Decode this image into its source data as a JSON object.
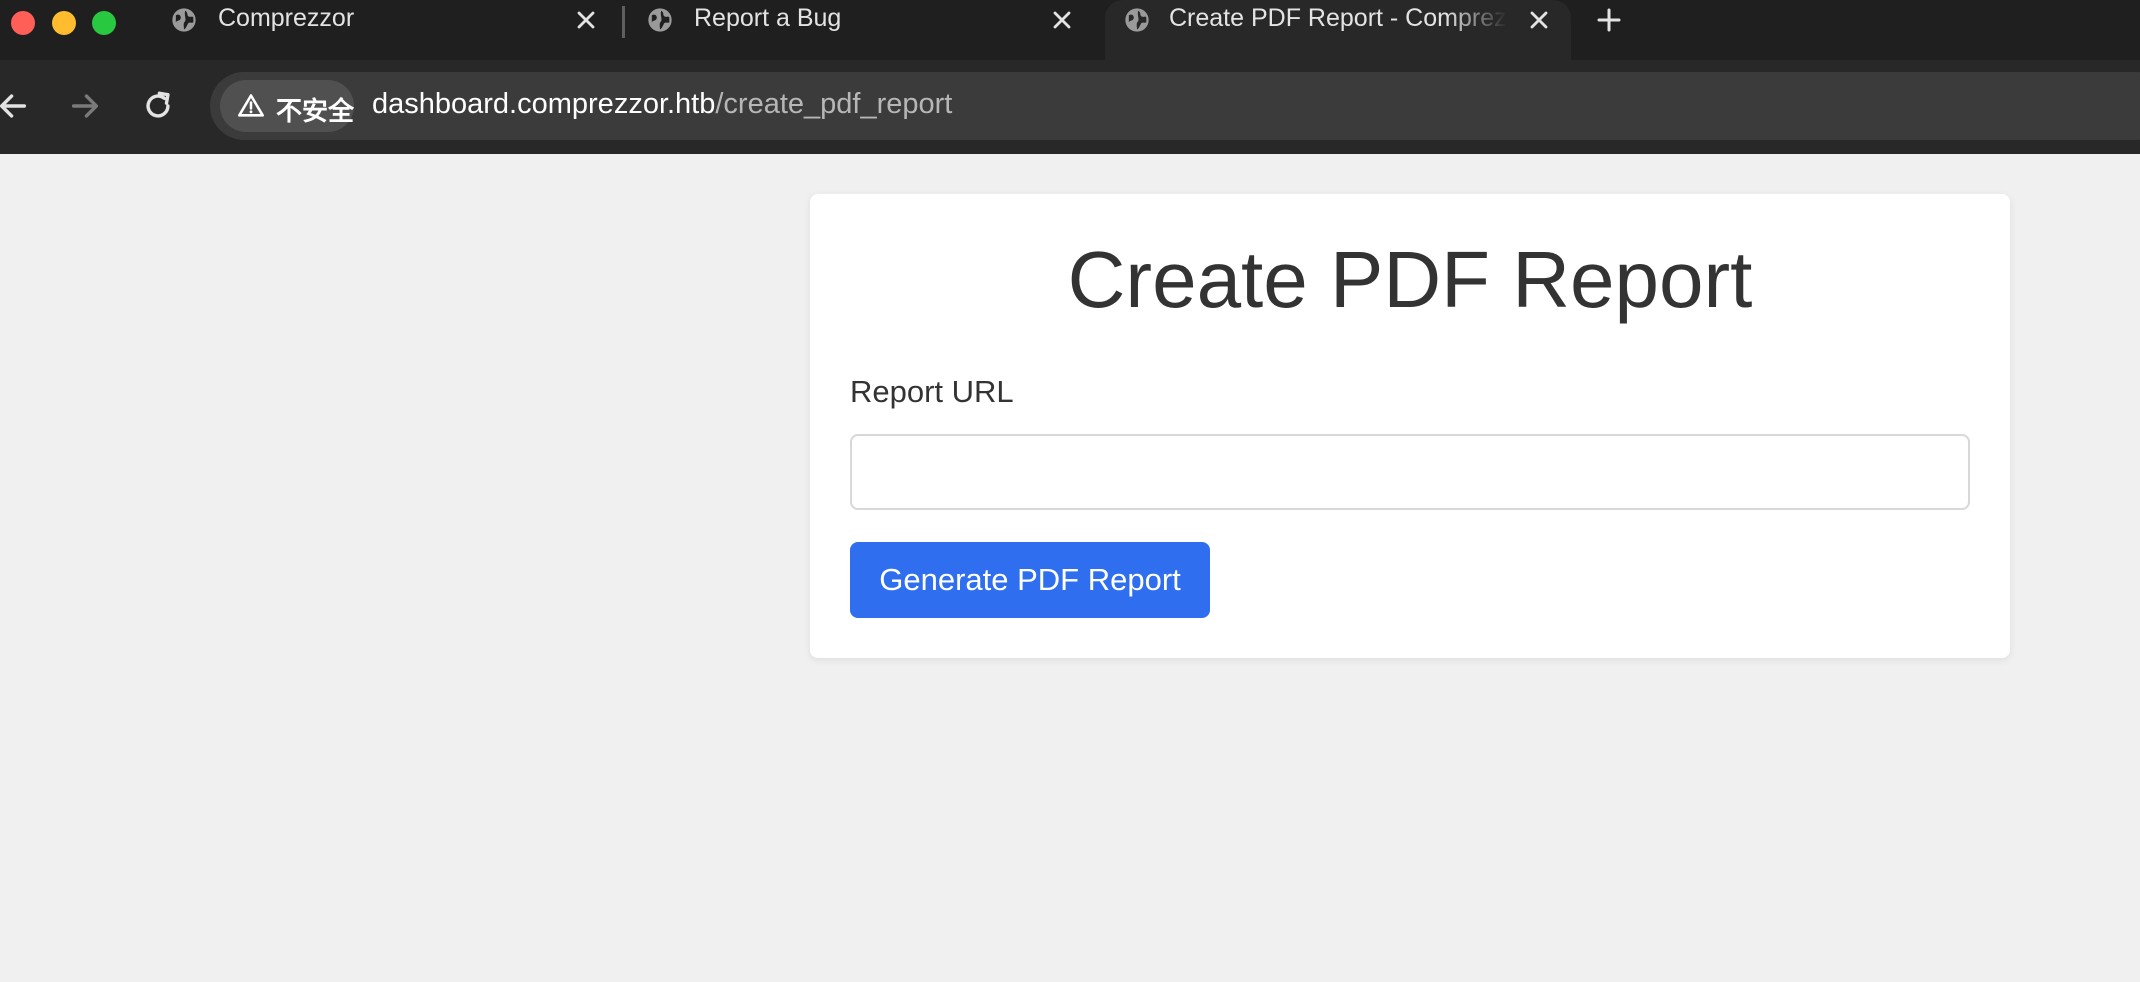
{
  "browser": {
    "tabs": [
      {
        "title": "Comprezzor",
        "active": false
      },
      {
        "title": "Report a Bug",
        "active": false
      },
      {
        "title": "Create PDF Report - Comprezzor",
        "active": true
      }
    ],
    "security_label": "不安全",
    "url_host": "dashboard.comprezzor.htb",
    "url_path": "/create_pdf_report"
  },
  "page": {
    "title": "Create PDF Report",
    "report_url_label": "Report URL",
    "report_url_value": "",
    "generate_button_label": "Generate PDF Report"
  },
  "colors": {
    "accent_button": "#2f6fef",
    "page_background": "#f0f0f0",
    "card_background": "#ffffff"
  },
  "icons": [
    "globe-icon",
    "close-icon",
    "plus-icon",
    "back-arrow-icon",
    "forward-arrow-icon",
    "reload-icon",
    "warning-icon"
  ]
}
